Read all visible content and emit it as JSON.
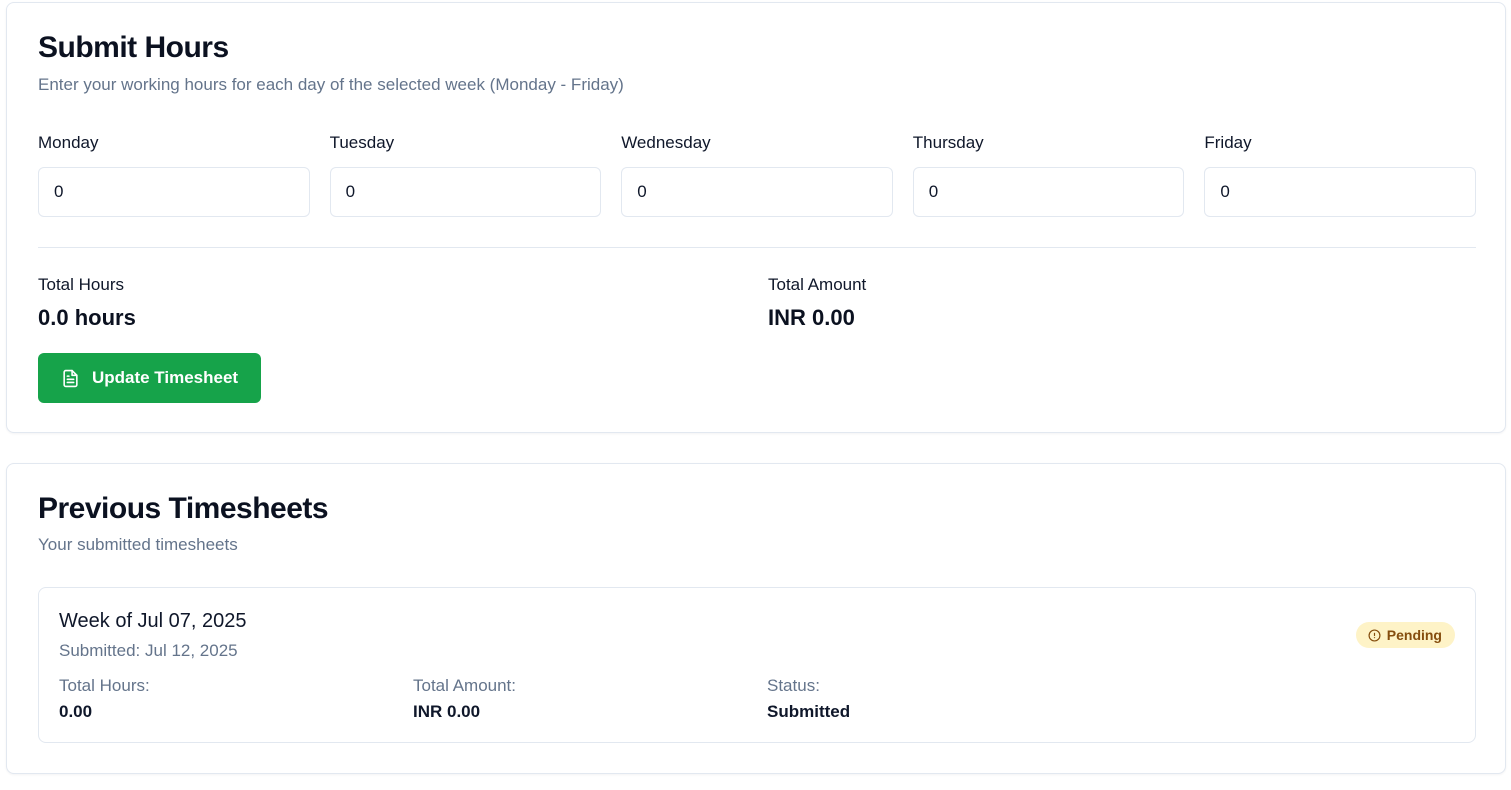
{
  "submit": {
    "title": "Submit Hours",
    "subtitle": "Enter your working hours for each day of the selected week (Monday - Friday)",
    "days": [
      {
        "label": "Monday",
        "value": "0"
      },
      {
        "label": "Tuesday",
        "value": "0"
      },
      {
        "label": "Wednesday",
        "value": "0"
      },
      {
        "label": "Thursday",
        "value": "0"
      },
      {
        "label": "Friday",
        "value": "0"
      }
    ],
    "total_hours_label": "Total Hours",
    "total_hours_value": "0.0 hours",
    "total_amount_label": "Total Amount",
    "total_amount_value": "INR 0.00",
    "button_label": "Update Timesheet",
    "button_icon": "file-text-icon",
    "accent_color": "#16a34a"
  },
  "previous": {
    "title": "Previous Timesheets",
    "subtitle": "Your submitted timesheets",
    "items": [
      {
        "week": "Week of Jul 07, 2025",
        "submitted": "Submitted: Jul 12, 2025",
        "badge": "Pending",
        "badge_icon": "alert-circle-icon",
        "badge_color": "#fef3c7",
        "total_hours_label": "Total Hours:",
        "total_hours_value": "0.00",
        "total_amount_label": "Total Amount:",
        "total_amount_value": "INR 0.00",
        "status_label": "Status:",
        "status_value": "Submitted"
      }
    ]
  }
}
